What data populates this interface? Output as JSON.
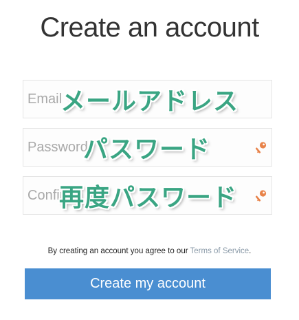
{
  "page": {
    "title": "Create an account"
  },
  "form": {
    "email": {
      "placeholder": "Email",
      "value": ""
    },
    "password": {
      "placeholder": "Password",
      "value": "",
      "icon": "key-icon"
    },
    "confirm": {
      "placeholder": "Confirm",
      "value": "",
      "icon": "key-icon"
    }
  },
  "overlay_labels": {
    "email": "メールアドレス",
    "password": "パスワード",
    "confirm": "再度パスワード"
  },
  "terms": {
    "text": "By creating an account you agree to our ",
    "link": "Terms of Service",
    "suffix": "."
  },
  "submit": {
    "label": "Create my account"
  },
  "colors": {
    "button": "#4a8ed1",
    "overlay_text": "#3aa583",
    "link": "#8a9aa8",
    "key_icon": "#e8834a"
  }
}
